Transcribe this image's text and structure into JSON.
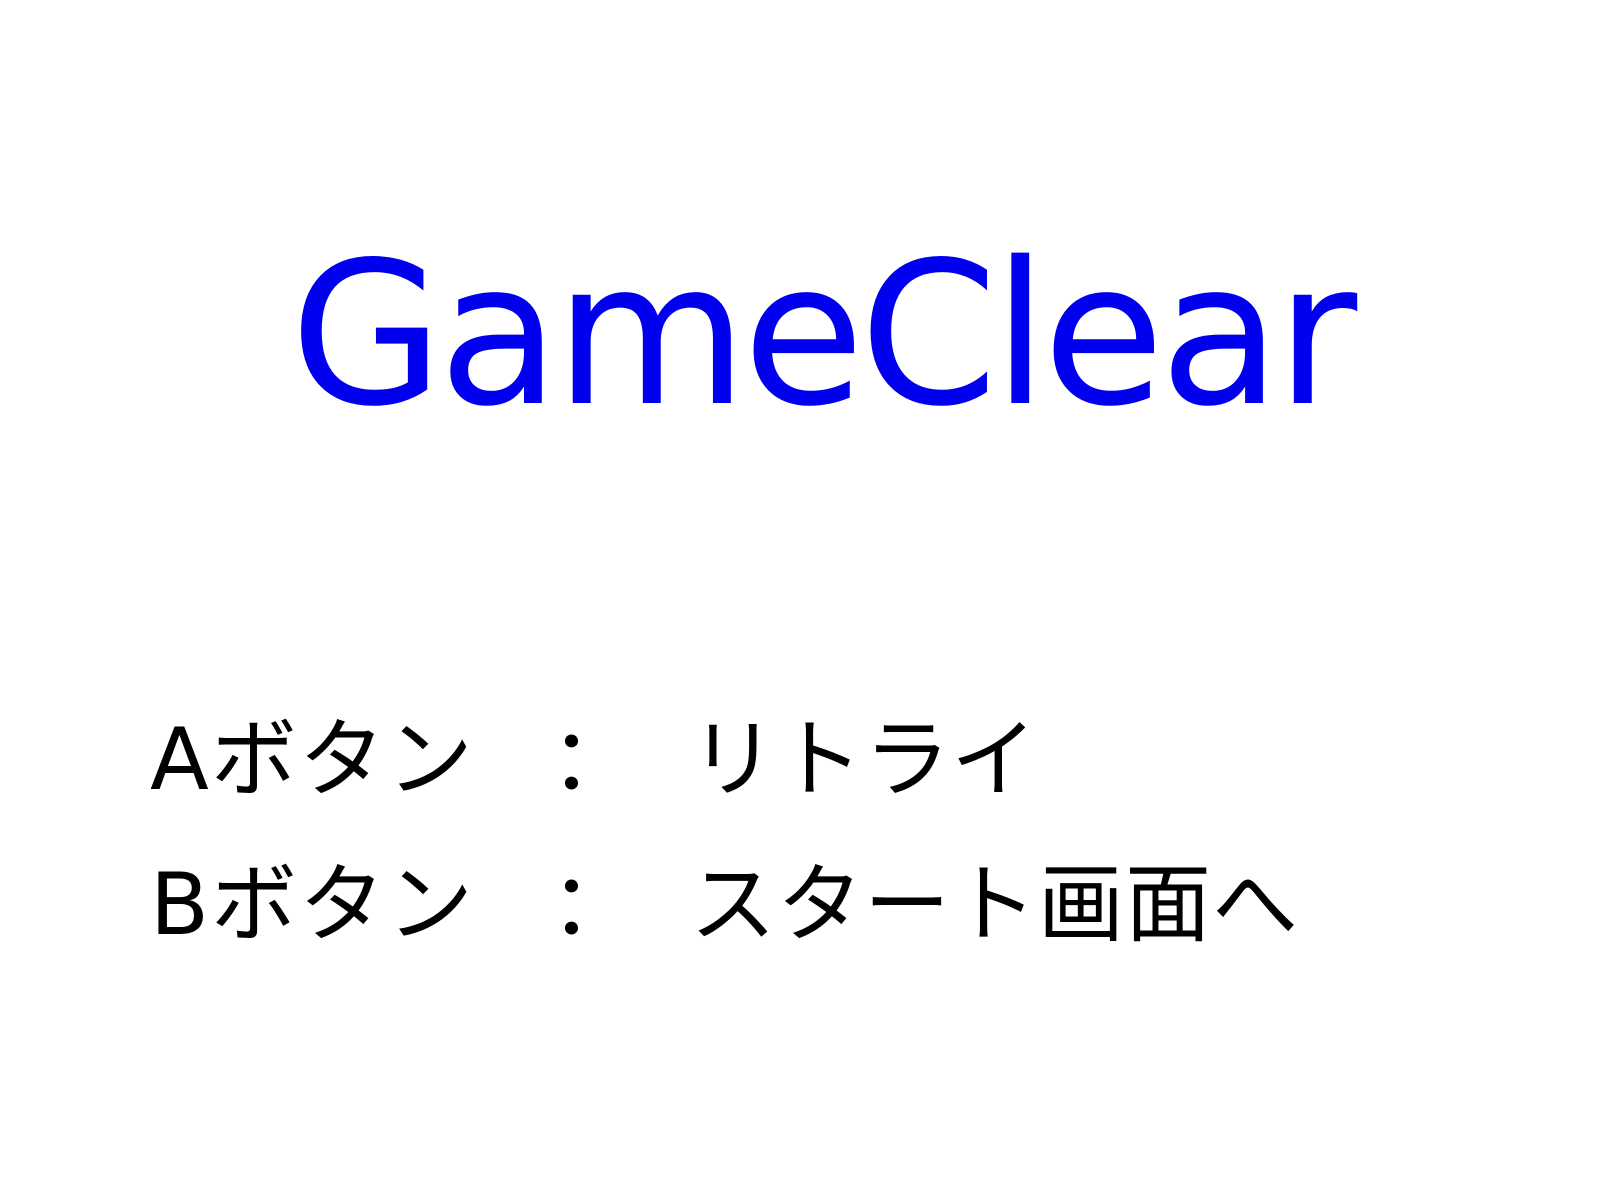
{
  "game_screen": {
    "title": "GameClear",
    "controls": [
      {
        "button": "Aボタン",
        "separator": "：",
        "action": "リトライ"
      },
      {
        "button": "Bボタン",
        "separator": "：",
        "action": "スタート画面へ"
      }
    ]
  },
  "colors": {
    "background": "#ffffff",
    "title": "#0000ee",
    "text": "#000000"
  }
}
